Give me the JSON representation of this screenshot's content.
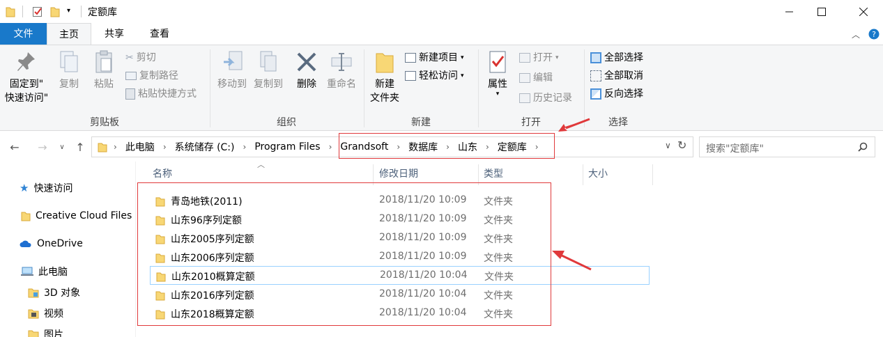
{
  "window": {
    "title": "定额库"
  },
  "tabs": [
    "文件",
    "主页",
    "共享",
    "查看"
  ],
  "ribbon": {
    "clipboard": {
      "label": "剪贴板",
      "pin": "固定到\"\n快速访问\"",
      "copy": "复制",
      "paste": "粘贴",
      "cut": "剪切",
      "copy_path": "复制路径",
      "paste_shortcut": "粘贴快捷方式"
    },
    "organize": {
      "label": "组织",
      "move_to": "移动到",
      "copy_to": "复制到",
      "delete": "删除",
      "rename": "重命名"
    },
    "new": {
      "label": "新建",
      "new_folder": "新建\n文件夹",
      "new_item": "新建项目",
      "easy_access": "轻松访问"
    },
    "open": {
      "label": "打开",
      "properties": "属性",
      "open": "打开",
      "edit": "编辑",
      "history": "历史记录"
    },
    "select": {
      "label": "选择",
      "select_all": "全部选择",
      "select_none": "全部取消",
      "invert": "反向选择"
    }
  },
  "address": {
    "crumbs": [
      "此电脑",
      "系统储存 (C:)",
      "Program Files",
      "Grandsoft",
      "数据库",
      "山东",
      "定额库"
    ],
    "search_placeholder": "搜索\"定额库\""
  },
  "sidebar": {
    "items": [
      "快速访问",
      "Creative Cloud Files",
      "OneDrive",
      "此电脑",
      "3D 对象",
      "视频",
      "图片"
    ]
  },
  "columns": {
    "name": "名称",
    "date": "修改日期",
    "type": "类型",
    "size": "大小"
  },
  "files": [
    {
      "name": "青岛地铁(2011)",
      "date": "2018/11/20 10:09",
      "type": "文件夹"
    },
    {
      "name": "山东96序列定额",
      "date": "2018/11/20 10:09",
      "type": "文件夹"
    },
    {
      "name": "山东2005序列定额",
      "date": "2018/11/20 10:09",
      "type": "文件夹"
    },
    {
      "name": "山东2006序列定额",
      "date": "2018/11/20 10:09",
      "type": "文件夹"
    },
    {
      "name": "山东2010概算定额",
      "date": "2018/11/20 10:04",
      "type": "文件夹"
    },
    {
      "name": "山东2016序列定额",
      "date": "2018/11/20 10:04",
      "type": "文件夹"
    },
    {
      "name": "山东2018概算定额",
      "date": "2018/11/20 10:04",
      "type": "文件夹"
    }
  ],
  "colors": {
    "accent": "#1979ca",
    "annotation": "#e0393b",
    "folder": "#f8d775"
  }
}
